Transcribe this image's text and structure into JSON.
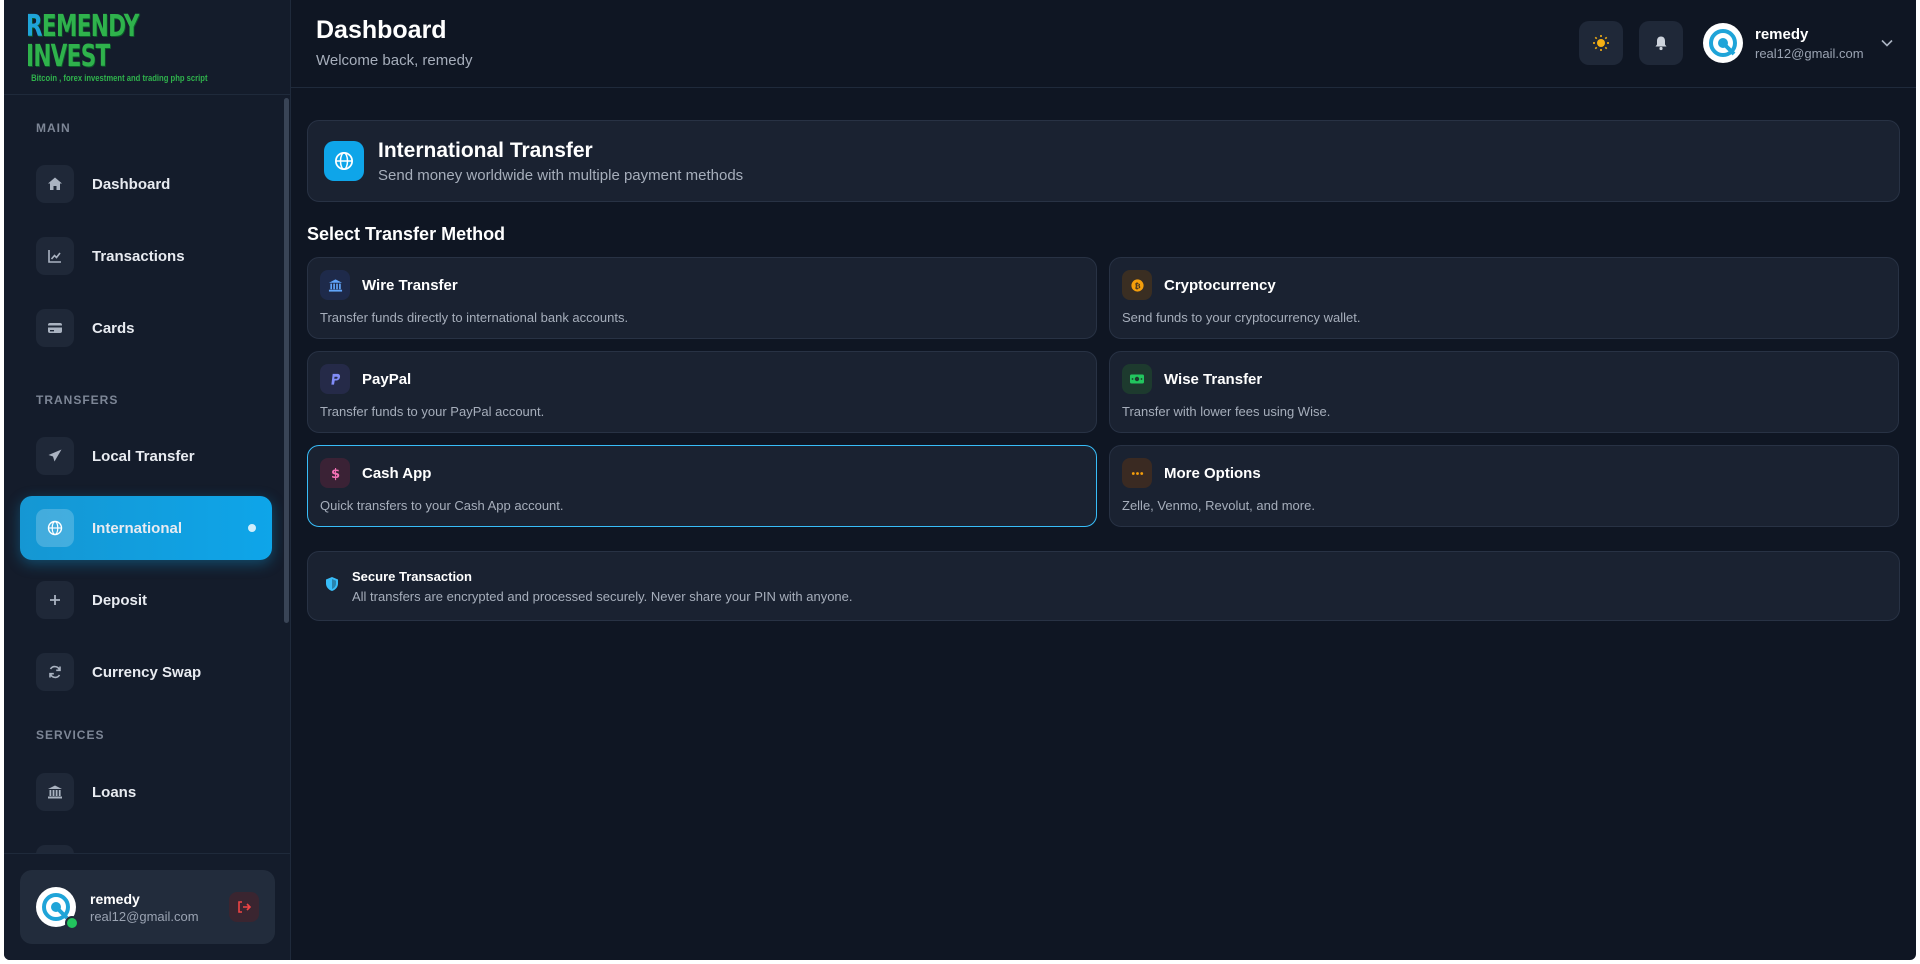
{
  "brand": {
    "logo_main": "EMENDY INVEST",
    "logo_first": "R",
    "logo_sub": "Bitcoin , forex investment and trading php script"
  },
  "sidebar": {
    "sections": {
      "main": "MAIN",
      "transfers": "TRANSFERS",
      "services": "SERVICES"
    },
    "items": [
      {
        "label": "Dashboard",
        "icon": "home-icon"
      },
      {
        "label": "Transactions",
        "icon": "chart-line-icon"
      },
      {
        "label": "Cards",
        "icon": "credit-card-icon"
      },
      {
        "label": "Local Transfer",
        "icon": "paper-plane-icon"
      },
      {
        "label": "International",
        "icon": "globe-icon",
        "active": true
      },
      {
        "label": "Deposit",
        "icon": "plus-icon"
      },
      {
        "label": "Currency Swap",
        "icon": "refresh-icon"
      },
      {
        "label": "Loans",
        "icon": "bank-icon"
      }
    ],
    "footer": {
      "name": "remedy",
      "email": "real12@gmail.com"
    }
  },
  "header": {
    "title": "Dashboard",
    "subtitle": "Welcome back, remedy",
    "user": {
      "name": "remedy",
      "email": "real12@gmail.com"
    }
  },
  "hero": {
    "title": "International Transfer",
    "subtitle": "Send money worldwide with multiple payment methods"
  },
  "methods_title": "Select Transfer Method",
  "methods": [
    {
      "title": "Wire Transfer",
      "desc": "Transfer funds directly to international bank accounts.",
      "icon": "bank-icon",
      "color": "#60a5fa",
      "bg": "#1e2a4a"
    },
    {
      "title": "Cryptocurrency",
      "desc": "Send funds to your cryptocurrency wallet.",
      "icon": "bitcoin-icon",
      "color": "#f59e0b",
      "bg": "#3a2e22"
    },
    {
      "title": "PayPal",
      "desc": "Transfer funds to your PayPal account.",
      "icon": "paypal-icon",
      "color": "#818cf8",
      "bg": "#252a48"
    },
    {
      "title": "Wise Transfer",
      "desc": "Transfer with lower fees using Wise.",
      "icon": "money-bill-icon",
      "color": "#22c55e",
      "bg": "#1d3a2e"
    },
    {
      "title": "Cash App",
      "desc": "Quick transfers to your Cash App account.",
      "icon": "dollar-icon",
      "color": "#f472b6",
      "bg": "#3a2235",
      "selected": true
    },
    {
      "title": "More Options",
      "desc": "Zelle, Venmo, Revolut, and more.",
      "icon": "ellipsis-icon",
      "color": "#f59e0b",
      "bg": "#3a2a22"
    }
  ],
  "secure": {
    "title": "Secure Transaction",
    "text": "All transfers are encrypted and processed securely. Never share your PIN with anyone."
  },
  "colors": {
    "accent": "#0ea5e9",
    "background": "#0f1623",
    "panel": "#1a2231"
  }
}
